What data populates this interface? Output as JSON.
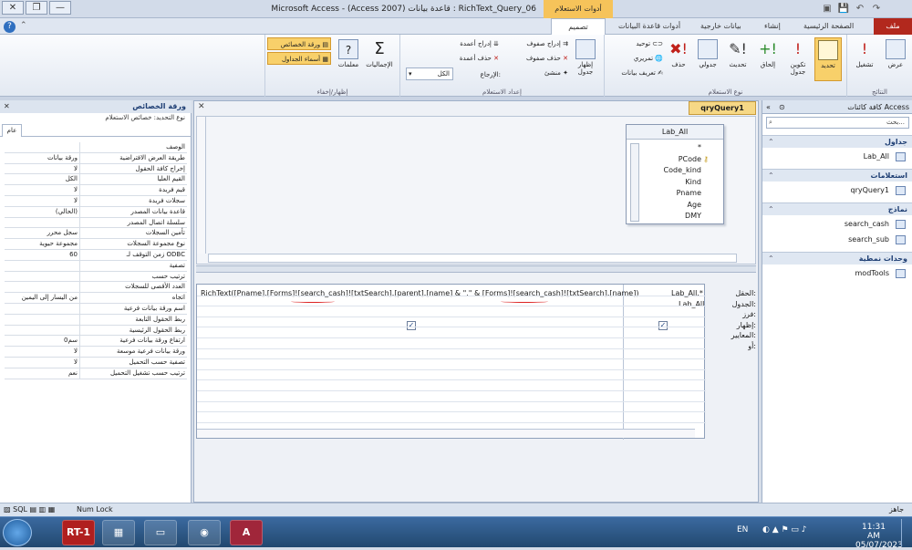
{
  "window": {
    "title": "Microsoft Access - (Access 2007) قاعدة بيانات : RichText_Query_06",
    "context_header": "أدوات الاستعلام"
  },
  "tabs": [
    "ملف",
    "الصفحة الرئيسية",
    "إنشاء",
    "بيانات خارجية",
    "أدوات قاعدة البيانات",
    "تصميم"
  ],
  "ribbon": {
    "results": {
      "label": "النتائج",
      "view": "عرض",
      "run": "تشغيل"
    },
    "query_type": {
      "label": "نوع الاستعلام",
      "select": "تحديد",
      "make_table": "تكوين جدول",
      "append": "إلحاق",
      "update": "تحديث",
      "crosstab": "جدولي",
      "delete": "حذف",
      "union": "توحيد",
      "pass_through": "تمريري",
      "data_definition": "تعريف بيانات"
    },
    "setup": {
      "label": "إعداد الاستعلام",
      "show_table": "إظهار جدول",
      "insert_rows": "إدراج صفوف",
      "delete_rows": "حذف صفوف",
      "builder": "منشئ",
      "insert_columns": "إدراج أعمدة",
      "delete_columns": "حذف أعمدة",
      "return_label": "الإرجاع:",
      "return_value": "الكل"
    },
    "show_hide": {
      "label": "إظهار/إخفاء",
      "totals": "الإجماليات",
      "parameters": "معلمات",
      "property_sheet": "ورقة الخصائص",
      "table_names": "أسماء الجداول"
    }
  },
  "nav": {
    "header": "كافة كائنات Access",
    "search_placeholder": "بحث...",
    "sections": [
      {
        "title": "جداول",
        "items": [
          "Lab_All"
        ]
      },
      {
        "title": "استعلامات",
        "items": [
          "qryQuery1"
        ]
      },
      {
        "title": "نماذج",
        "items": [
          "search_cash",
          "search_sub"
        ]
      },
      {
        "title": "وحدات نمطية",
        "items": [
          "modTools"
        ]
      }
    ]
  },
  "query": {
    "tab": "qryQuery1",
    "table": {
      "title": "Lab_All",
      "fields": [
        "*",
        "PCode",
        "Code_kind",
        "Kind",
        "Pname",
        "Age",
        "DMY"
      ]
    },
    "row_labels": [
      "الحقل:",
      "الجدول:",
      "فرز:",
      "إظهار:",
      "المعايير:",
      "أو:"
    ],
    "col1": {
      "field": "Lab_All.*",
      "table": "Lab_All",
      "show": "✓"
    },
    "col2": {
      "field": "RichText([Pname],[Forms]![search_cash]![txtSearch].[parent].[name] & \",\" & [Forms]![search_cash]![txtSearch].[name])",
      "show": "✓"
    }
  },
  "properties": {
    "title": "ورقة الخصائص",
    "selection": "نوع التحديد:  خصائص الاستعلام",
    "tab": "عام",
    "rows": [
      {
        "label": "الوصف",
        "value": ""
      },
      {
        "label": "طريقة العرض الافتراضية",
        "value": "ورقة بيانات"
      },
      {
        "label": "إخراج كافة الحقول",
        "value": "لا"
      },
      {
        "label": "القيم العليا",
        "value": "الكل"
      },
      {
        "label": "قيم فريدة",
        "value": "لا"
      },
      {
        "label": "سجلات فريدة",
        "value": "لا"
      },
      {
        "label": "قاعدة بيانات المصدر",
        "value": "(الحالي)"
      },
      {
        "label": "سلسلة اتصال المصدر",
        "value": ""
      },
      {
        "label": "تأمين السجلات",
        "value": "سجل محرر"
      },
      {
        "label": "نوع مجموعة السجلات",
        "value": "مجموعة حيوية"
      },
      {
        "label": "زمن التوقف لـ ODBC",
        "value": "60"
      },
      {
        "label": "تصفية",
        "value": ""
      },
      {
        "label": "ترتيب حسب",
        "value": ""
      },
      {
        "label": "العدد الأقصى للسجلات",
        "value": ""
      },
      {
        "label": "اتجاه",
        "value": "من اليسار إلى اليمين"
      },
      {
        "label": "اسم ورقة بيانات فرعية",
        "value": ""
      },
      {
        "label": "ربط الحقول التابعة",
        "value": ""
      },
      {
        "label": "ربط الحقول الرئيسية",
        "value": ""
      },
      {
        "label": "ارتفاع ورقة بيانات فرعية",
        "value": "0سم"
      },
      {
        "label": "ورقة بيانات فرعية موسعة",
        "value": "لا"
      },
      {
        "label": "تصفية حسب التحميل",
        "value": "لا"
      },
      {
        "label": "ترتيب حسب تشغيل التحميل",
        "value": "نعم"
      }
    ]
  },
  "status": {
    "left": "Num Lock",
    "right": "جاهز",
    "sql": "SQL"
  },
  "taskbar": {
    "app1": "RT-1",
    "time": "11:31 AM",
    "date": "05/07/2023",
    "lang": "EN"
  }
}
